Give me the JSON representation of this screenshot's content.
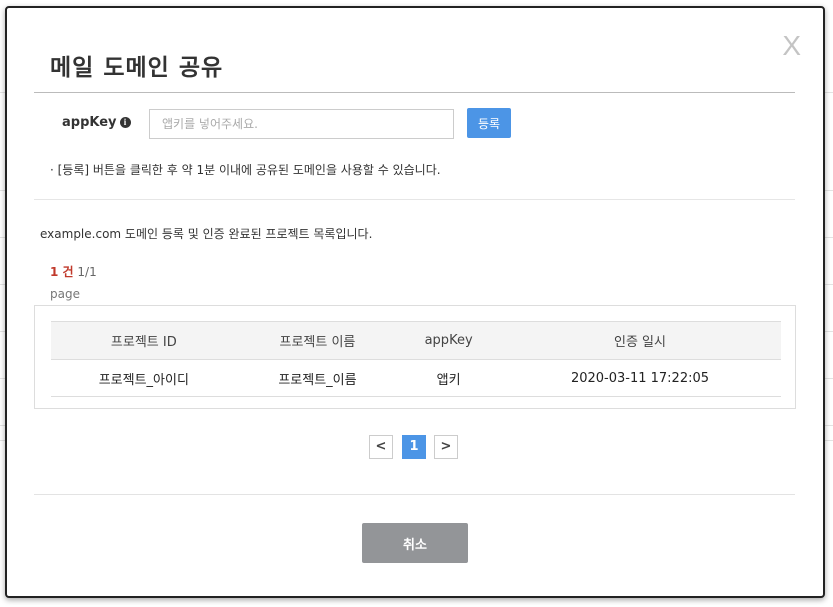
{
  "modal": {
    "title": "메일 도메인 공유",
    "close_label": "X"
  },
  "form": {
    "appkey_label": "appKey",
    "info_icon_glyph": "i",
    "appkey_placeholder": "앱키를 넣어주세요.",
    "appkey_value": "",
    "register_label": "등록",
    "notice": "· [등록] 버튼을 클릭한 후 약 1분 이내에 공유된 도메인을 사용할 수 있습니다."
  },
  "list": {
    "description": "example.com 도메인 등록 및 인증 완료된 프로젝트 목록입니다.",
    "count_value": "1 건",
    "page_info": "1/1",
    "page_word": "page",
    "columns": [
      "프로젝트 ID",
      "프로젝트 이름",
      "appKey",
      "인증 일시"
    ],
    "rows": [
      [
        "프로젝트_아이디",
        "프로젝트_이름",
        "앱키",
        "2020-03-11 17:22:05"
      ]
    ]
  },
  "pagination": {
    "prev": "<",
    "current": "1",
    "next": ">"
  },
  "footer": {
    "cancel_label": "취소"
  },
  "colors": {
    "primary_button": "#4c95e6",
    "cancel_button": "#939598",
    "count_highlight": "#c0392b"
  }
}
